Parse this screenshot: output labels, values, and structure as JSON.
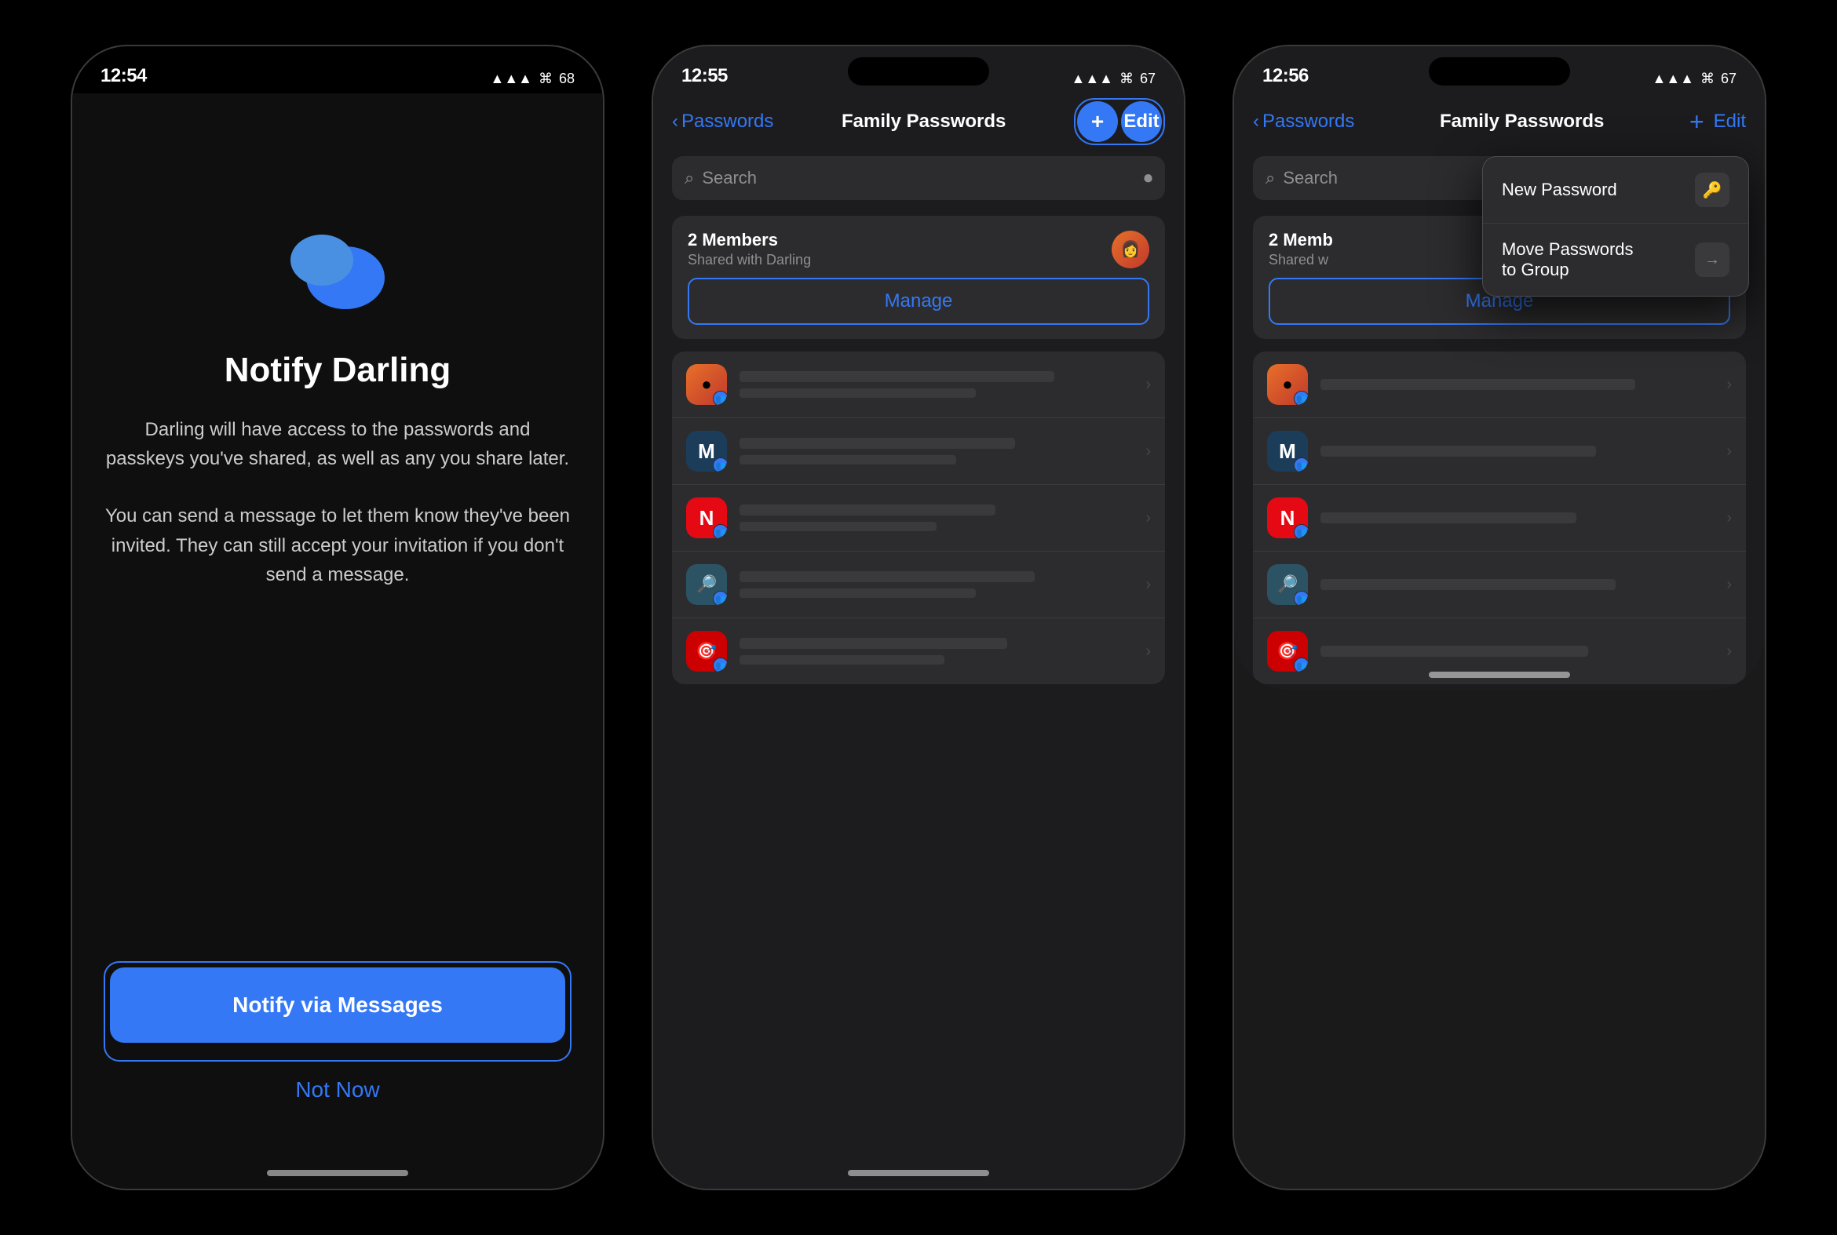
{
  "page": {
    "background": "#000000"
  },
  "phone1": {
    "time": "12:54",
    "title": "Notify Darling",
    "body1": "Darling will have access to the passwords and passkeys you've shared, as well as any you share later.",
    "body2": "You can send a message to let them know they've been invited. They can still accept your invitation if you don't send a message.",
    "btn_notify": "Notify via Messages",
    "btn_not_now": "Not Now",
    "status_icons": "▲ ▲▲ ⓦ 68"
  },
  "phone2": {
    "time": "12:55",
    "back_label": "Passwords",
    "nav_title": "Family Passwords",
    "btn_plus": "+",
    "btn_edit": "Edit",
    "search_placeholder": "Search",
    "group_members": "2 Members",
    "group_shared": "Shared with Darling",
    "manage_label": "Manage",
    "passwords": [
      {
        "app": "🟠",
        "icon_class": "icon-orange",
        "name": "",
        "detail": ""
      },
      {
        "app": "M",
        "icon_class": "icon-blue-dark",
        "name": "",
        "detail": ""
      },
      {
        "app": "N",
        "icon_class": "icon-red",
        "name": "",
        "detail": ""
      },
      {
        "app": "🔍",
        "icon_class": "icon-teal",
        "name": "",
        "detail": ""
      },
      {
        "app": "🎯",
        "icon_class": "icon-red2",
        "name": "",
        "detail": ""
      }
    ]
  },
  "phone3": {
    "time": "12:56",
    "back_label": "Passwords",
    "nav_title": "Family Passwords",
    "btn_plus": "+",
    "btn_edit": "Edit",
    "search_placeholder": "Search",
    "group_members": "2 Memb",
    "group_shared": "Shared w",
    "manage_label": "Manage",
    "dropdown": {
      "item1_label": "New Password",
      "item2_label": "Move Passwords to Group",
      "item1_icon": "🔑",
      "item2_icon": "→"
    },
    "passwords": [
      {
        "app": "🟠",
        "icon_class": "icon-orange"
      },
      {
        "app": "M",
        "icon_class": "icon-blue-dark"
      },
      {
        "app": "N",
        "icon_class": "icon-red"
      },
      {
        "app": "🔍",
        "icon_class": "icon-teal"
      },
      {
        "app": "🎯",
        "icon_class": "icon-red2"
      }
    ]
  }
}
